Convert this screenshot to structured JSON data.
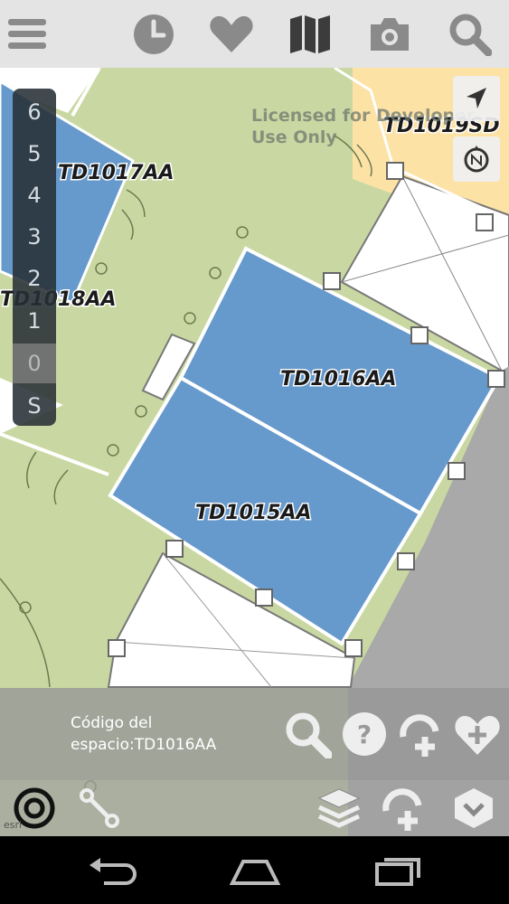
{
  "toolbar": {
    "icons": [
      "menu-icon",
      "clock-icon",
      "heart-icon",
      "map-icon",
      "camera-icon",
      "search-icon"
    ]
  },
  "map": {
    "watermark_line1": "Licensed for Developer",
    "watermark_line2": "Use Only",
    "rooms": {
      "td1017aa": "TD1017AA",
      "td1018aa": "TD1018AA",
      "td1016aa": "TD1016AA",
      "td1015aa": "TD1015AA",
      "td1019sd": "TD1019SD"
    },
    "floors": [
      "6",
      "5",
      "4",
      "3",
      "2",
      "1",
      "0",
      "S"
    ],
    "selected_floor": "0",
    "attribution": "esri",
    "colors": {
      "room_blue": "#6699cc",
      "corridor_green": "#c9d8a2",
      "room_yellow": "#fde2a6"
    }
  },
  "info": {
    "label_line1": "Código del",
    "label_line2": "espacio:TD1016AA"
  },
  "bottom_bar": {
    "icons": [
      "locate-target-icon",
      "route-icon",
      "layers-icon",
      "add-location-icon",
      "expand-icon"
    ]
  },
  "android_nav": {
    "icons": [
      "back-icon",
      "home-icon",
      "recents-icon"
    ]
  }
}
